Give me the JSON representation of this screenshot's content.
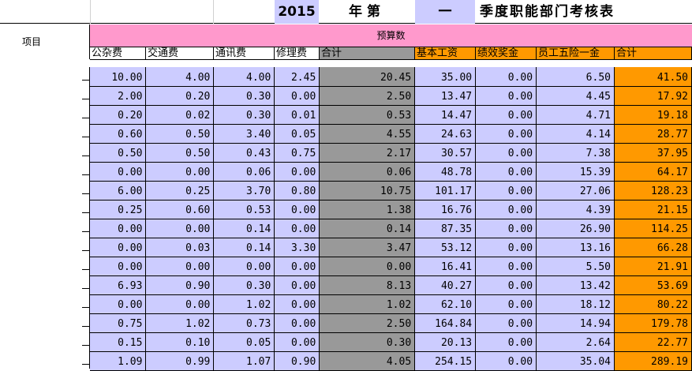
{
  "title": {
    "year": "2015",
    "nian_di": "年第",
    "quarter": "一",
    "rest": "季度职能部门考核表"
  },
  "header": {
    "item_label": "项目",
    "budget_label": "预算数",
    "columns": [
      "公杂费",
      "交通费",
      "通讯费",
      "修理费",
      "合计",
      "基本工资",
      "绩效奖金",
      "员工五险一金",
      "合计"
    ]
  },
  "rows": [
    [
      "10.00",
      "4.00",
      "4.00",
      "2.45",
      "20.45",
      "35.00",
      "0.00",
      "6.50",
      "41.50"
    ],
    [
      "2.00",
      "0.20",
      "0.30",
      "0.00",
      "2.50",
      "13.47",
      "0.00",
      "4.45",
      "17.92"
    ],
    [
      "0.20",
      "0.02",
      "0.30",
      "0.01",
      "0.53",
      "14.47",
      "0.00",
      "4.71",
      "19.18"
    ],
    [
      "0.60",
      "0.50",
      "3.40",
      "0.05",
      "4.55",
      "24.63",
      "0.00",
      "4.14",
      "28.77"
    ],
    [
      "0.50",
      "0.50",
      "0.43",
      "0.75",
      "2.17",
      "30.57",
      "0.00",
      "7.38",
      "37.95"
    ],
    [
      "0.00",
      "0.00",
      "0.06",
      "0.00",
      "0.06",
      "48.78",
      "0.00",
      "15.39",
      "64.17"
    ],
    [
      "6.00",
      "0.25",
      "3.70",
      "0.80",
      "10.75",
      "101.17",
      "0.00",
      "27.06",
      "128.23"
    ],
    [
      "0.25",
      "0.60",
      "0.53",
      "0.00",
      "1.38",
      "16.76",
      "0.00",
      "4.39",
      "21.15"
    ],
    [
      "0.00",
      "0.00",
      "0.14",
      "0.00",
      "0.14",
      "87.35",
      "0.00",
      "26.90",
      "114.25"
    ],
    [
      "0.00",
      "0.03",
      "0.14",
      "3.30",
      "3.47",
      "53.12",
      "0.00",
      "13.16",
      "66.28"
    ],
    [
      "0.00",
      "0.00",
      "0.00",
      "0.00",
      "0.00",
      "16.41",
      "0.00",
      "5.50",
      "21.91"
    ],
    [
      "6.93",
      "0.90",
      "0.30",
      "0.00",
      "8.13",
      "40.27",
      "0.00",
      "13.42",
      "53.69"
    ],
    [
      "0.00",
      "0.00",
      "1.02",
      "0.00",
      "1.02",
      "62.10",
      "0.00",
      "18.12",
      "80.22"
    ],
    [
      "0.75",
      "1.02",
      "0.73",
      "0.00",
      "2.50",
      "164.84",
      "0.00",
      "14.94",
      "179.78"
    ],
    [
      "0.15",
      "0.10",
      "0.05",
      "0.00",
      "0.30",
      "20.13",
      "0.00",
      "2.64",
      "22.77"
    ],
    [
      "1.09",
      "0.99",
      "1.07",
      "0.90",
      "4.05",
      "254.15",
      "0.00",
      "35.04",
      "289.19"
    ]
  ],
  "colors": {
    "lavender": "#ccccff",
    "gray": "#999999",
    "orange": "#ff9900",
    "pink": "#ff99cc"
  }
}
